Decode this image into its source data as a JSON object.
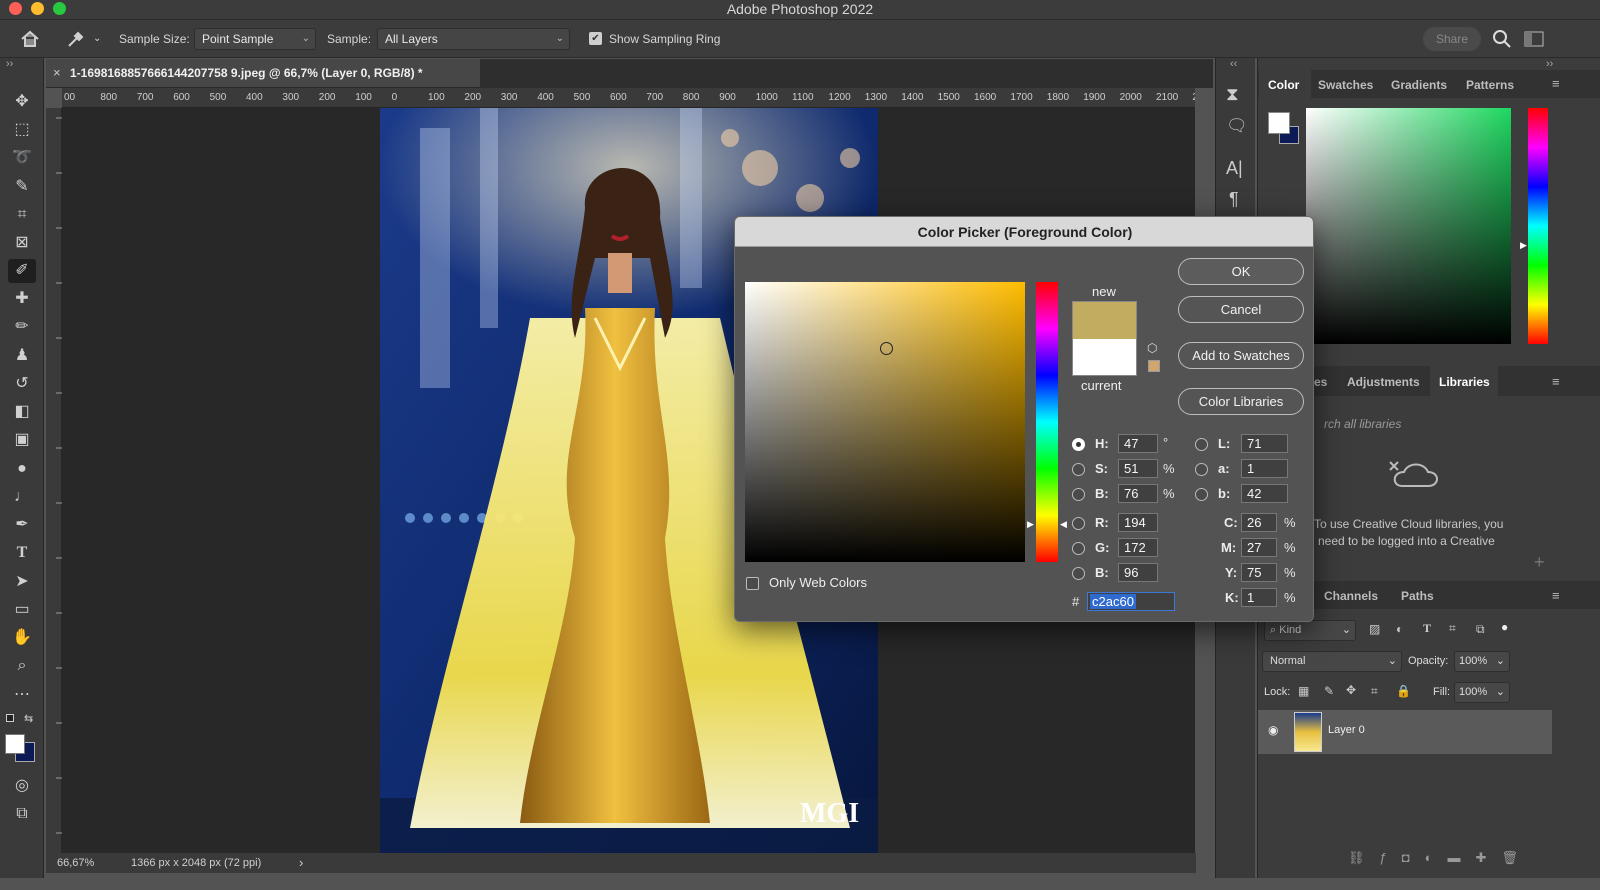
{
  "app": {
    "title": "Adobe Photoshop 2022"
  },
  "options_bar": {
    "sample_size_label": "Sample Size:",
    "sample_size_value": "Point Sample",
    "sample_label": "Sample:",
    "sample_value": "All Layers",
    "show_ring_label": "Show Sampling Ring",
    "show_ring_checked": true,
    "share_label": "Share"
  },
  "document": {
    "tab_title": "1-1698168857666144207758 9.jpeg @ 66,7% (Layer 0, RGB/8) *",
    "zoom": "66,67%",
    "dimensions": "1366 px x 2048 px (72 ppi)"
  },
  "ruler": {
    "h_labels": [
      "00",
      "800",
      "700",
      "600",
      "500",
      "400",
      "300",
      "200",
      "100",
      "0",
      "100",
      "200",
      "300",
      "400",
      "500",
      "600",
      "700",
      "800",
      "900",
      "1000",
      "1100",
      "1200",
      "1300",
      "1400",
      "1500",
      "1600",
      "1700",
      "1800",
      "1900",
      "2000",
      "2100",
      "22"
    ]
  },
  "panels": {
    "color_tabs": [
      "Color",
      "Swatches",
      "Gradients",
      "Patterns"
    ],
    "library_tabs": [
      "es",
      "Adjustments",
      "Libraries"
    ],
    "search_placeholder": "rch all libraries",
    "cc_message_line1": "To use Creative Cloud libraries, you",
    "cc_message_line2": "need to be logged into a Creative",
    "layers_tabs": [
      "Channels",
      "Paths"
    ],
    "kind_label": "Kind",
    "blend_mode": "Normal",
    "opacity_label": "Opacity:",
    "opacity_value": "100%",
    "lock_label": "Lock:",
    "fill_label": "Fill:",
    "fill_value": "100%",
    "layer_name": "Layer 0"
  },
  "color_picker": {
    "title": "Color Picker (Foreground Color)",
    "ok": "OK",
    "cancel": "Cancel",
    "add_swatches": "Add to Swatches",
    "color_libraries": "Color Libraries",
    "new_label": "new",
    "current_label": "current",
    "new_color": "#c2ac60",
    "current_color": "#ffffff",
    "only_web_colors": "Only Web Colors",
    "hsb": {
      "h": "47",
      "s": "51",
      "b": "76"
    },
    "lab": {
      "l": "71",
      "a": "1",
      "b": "42"
    },
    "rgb": {
      "r": "194",
      "g": "172",
      "b": "96"
    },
    "cmyk": {
      "c": "26",
      "m": "27",
      "y": "75",
      "k": "1"
    },
    "hex_symbol": "#",
    "hex": "c2ac60",
    "labels": {
      "H": "H:",
      "S": "S:",
      "B": "B:",
      "L": "L:",
      "a": "a:",
      "b": "b:",
      "R": "R:",
      "G": "G:",
      "Bl": "B:",
      "C": "C:",
      "M": "M:",
      "Y": "Y:",
      "K": "K:"
    },
    "units": {
      "deg": "°",
      "pct": "%"
    }
  },
  "watermark": "MGI"
}
